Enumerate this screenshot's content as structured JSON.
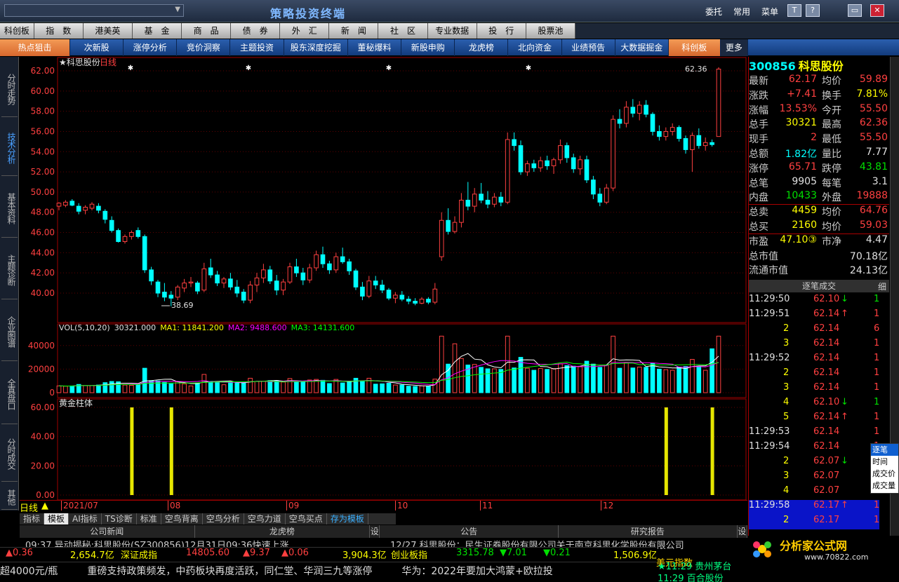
{
  "titlebar": {
    "app_title": "策略投资终端",
    "buttons": [
      "委托",
      "常用",
      "菜单"
    ],
    "win": [
      "T",
      "?",
      "▭",
      "✕"
    ]
  },
  "menubar": [
    "科创板",
    "指　数",
    "港美英",
    "基　金",
    "商　品",
    "债　券",
    "外　汇",
    "新　闻",
    "社　区",
    "专业数据",
    "投　行",
    "股票池"
  ],
  "subbar": [
    "热点狙击",
    "次新股",
    "涨停分析",
    "竞价洞察",
    "主题投资",
    "股东深度挖掘",
    "董秘爆料",
    "新股申购",
    "龙虎榜",
    "北向资金",
    "业绩预告",
    "大数据掘金",
    "科创板",
    "更多"
  ],
  "lefttabs": [
    "分时走势",
    "技术分析",
    "基本资料",
    "主题诊断",
    "企业图谱",
    "全真盘口",
    "分时成交",
    "其他"
  ],
  "chart": {
    "title": "★科思股份",
    "period": "日线",
    "price_axis": [
      "62.00",
      "60.00",
      "58.00",
      "56.00",
      "54.00",
      "52.00",
      "50.00",
      "48.00",
      "46.00",
      "44.00",
      "42.00",
      "40.00"
    ],
    "high_label": "62.36",
    "low_label": "38.69",
    "vol_legend": {
      "name": "VOL(5,10,20)",
      "vol": "30321.000",
      "ma1": "MA1: 11841.200",
      "ma2": "MA2: 9488.600",
      "ma3": "MA3: 14131.600"
    },
    "vol_axis": [
      "40000",
      "20000",
      "0"
    ],
    "gold_title": "黄金柱体",
    "gold_axis": [
      "60.00",
      "40.00",
      "20.00",
      "0.00"
    ],
    "date_labels": [
      "2021/07",
      "08",
      "09",
      "10",
      "11",
      "12"
    ],
    "period_label": "日线"
  },
  "chart_data": {
    "type": "candlestick",
    "title": "科思股份 日线",
    "ylim": [
      38,
      63
    ],
    "candles": [
      [
        48.6,
        49.0,
        48.2,
        48.9
      ],
      [
        48.7,
        49.2,
        48.5,
        49.0
      ],
      [
        49.1,
        49.3,
        48.6,
        48.7
      ],
      [
        48.6,
        48.9,
        47.8,
        48.1
      ],
      [
        48.2,
        48.7,
        47.8,
        48.5
      ],
      [
        48.4,
        49.0,
        48.2,
        48.8
      ],
      [
        48.6,
        48.9,
        47.9,
        48.2
      ],
      [
        48.1,
        48.3,
        46.9,
        47.3
      ],
      [
        47.2,
        47.6,
        46.0,
        46.2
      ],
      [
        46.2,
        46.4,
        45.0,
        45.1
      ],
      [
        45.1,
        45.8,
        44.9,
        45.6
      ],
      [
        45.6,
        46.2,
        45.3,
        46.0
      ],
      [
        46.2,
        46.5,
        45.4,
        45.6
      ],
      [
        45.6,
        45.8,
        42.0,
        42.3
      ],
      [
        42.3,
        42.6,
        40.8,
        41.2
      ],
      [
        41.1,
        41.3,
        39.6,
        40.0
      ],
      [
        40.1,
        41.0,
        39.2,
        39.6
      ],
      [
        39.8,
        40.2,
        38.7,
        39.5
      ],
      [
        39.6,
        40.8,
        39.3,
        40.6
      ],
      [
        40.5,
        41.4,
        40.1,
        41.0
      ],
      [
        41.0,
        41.6,
        40.6,
        41.1
      ],
      [
        41.0,
        41.2,
        39.9,
        40.2
      ],
      [
        40.3,
        43.0,
        40.1,
        42.4
      ],
      [
        42.5,
        43.4,
        41.5,
        41.8
      ],
      [
        41.8,
        42.2,
        40.7,
        41.0
      ],
      [
        41.0,
        41.6,
        40.5,
        41.4
      ],
      [
        41.4,
        42.0,
        40.3,
        40.6
      ],
      [
        40.6,
        41.3,
        39.6,
        40.0
      ],
      [
        40.1,
        40.4,
        39.0,
        39.3
      ],
      [
        39.3,
        41.2,
        39.0,
        40.8
      ],
      [
        40.8,
        42.0,
        40.1,
        41.5
      ],
      [
        41.5,
        42.9,
        41.0,
        42.3
      ],
      [
        42.3,
        42.7,
        40.9,
        41.2
      ],
      [
        41.2,
        41.8,
        39.8,
        40.3
      ],
      [
        40.3,
        41.4,
        39.8,
        41.1
      ],
      [
        41.1,
        43.0,
        40.9,
        42.6
      ],
      [
        42.6,
        43.4,
        41.6,
        42.0
      ],
      [
        42.0,
        42.5,
        40.8,
        41.3
      ],
      [
        41.3,
        42.9,
        41.0,
        42.5
      ],
      [
        42.5,
        44.2,
        42.2,
        43.8
      ],
      [
        43.8,
        44.6,
        42.5,
        42.9
      ],
      [
        42.9,
        43.2,
        41.9,
        42.3
      ],
      [
        42.3,
        44.0,
        42.0,
        43.6
      ],
      [
        43.6,
        44.5,
        42.9,
        43.1
      ],
      [
        43.1,
        43.4,
        41.8,
        42.2
      ],
      [
        42.2,
        42.4,
        40.3,
        40.6
      ],
      [
        40.6,
        41.1,
        39.3,
        39.7
      ],
      [
        39.7,
        41.7,
        39.5,
        41.2
      ],
      [
        41.2,
        41.7,
        40.4,
        40.8
      ],
      [
        40.8,
        41.3,
        40.0,
        40.3
      ],
      [
        40.3,
        40.5,
        39.3,
        39.5
      ],
      [
        39.5,
        40.1,
        39.0,
        39.8
      ],
      [
        39.8,
        40.2,
        39.2,
        39.4
      ],
      [
        39.4,
        39.7,
        38.9,
        39.2
      ],
      [
        39.2,
        39.5,
        38.8,
        39.0
      ],
      [
        39.0,
        39.6,
        38.9,
        39.4
      ],
      [
        39.4,
        39.6,
        38.9,
        39.1
      ],
      [
        39.1,
        41.0,
        38.9,
        40.4
      ],
      [
        43.6,
        48.0,
        43.2,
        47.2
      ],
      [
        47.2,
        48.4,
        45.8,
        46.1
      ],
      [
        46.1,
        47.6,
        45.9,
        47.0
      ],
      [
        47.0,
        49.9,
        46.5,
        49.2
      ],
      [
        49.2,
        51.0,
        48.2,
        48.6
      ],
      [
        48.6,
        50.4,
        48.0,
        49.8
      ],
      [
        49.8,
        50.9,
        48.9,
        49.2
      ],
      [
        49.2,
        50.1,
        48.4,
        48.8
      ],
      [
        48.8,
        49.9,
        48.5,
        49.5
      ],
      [
        49.5,
        50.0,
        48.6,
        49.0
      ],
      [
        49.0,
        55.9,
        48.8,
        55.2
      ],
      [
        55.2,
        55.9,
        54.1,
        54.6
      ],
      [
        54.6,
        55.1,
        51.7,
        52.0
      ],
      [
        52.0,
        53.1,
        51.6,
        52.8
      ],
      [
        52.8,
        53.2,
        52.0,
        52.4
      ],
      [
        52.4,
        53.5,
        52.0,
        53.1
      ],
      [
        53.1,
        53.6,
        52.2,
        52.6
      ],
      [
        52.6,
        53.4,
        51.8,
        53.2
      ],
      [
        53.2,
        55.2,
        52.8,
        54.6
      ],
      [
        54.6,
        54.9,
        52.9,
        53.4
      ],
      [
        53.4,
        53.8,
        51.9,
        52.3
      ],
      [
        52.3,
        53.6,
        51.7,
        53.2
      ],
      [
        53.2,
        53.6,
        50.9,
        51.2
      ],
      [
        51.2,
        51.6,
        49.3,
        49.8
      ],
      [
        49.8,
        50.4,
        48.6,
        49.0
      ],
      [
        49.0,
        50.8,
        48.8,
        50.4
      ],
      [
        50.4,
        57.6,
        50.1,
        57.2
      ],
      [
        57.2,
        58.2,
        56.3,
        56.8
      ],
      [
        56.8,
        59.0,
        56.4,
        58.4
      ],
      [
        58.4,
        59.2,
        57.4,
        57.8
      ],
      [
        57.8,
        59.0,
        57.1,
        58.6
      ],
      [
        58.6,
        59.1,
        57.4,
        57.7
      ],
      [
        57.7,
        57.9,
        55.6,
        56.0
      ],
      [
        56.0,
        56.6,
        55.1,
        55.5
      ],
      [
        55.5,
        56.4,
        55.1,
        56.0
      ],
      [
        56.0,
        56.8,
        55.6,
        56.4
      ],
      [
        56.4,
        56.6,
        55.0,
        55.3
      ],
      [
        55.3,
        55.6,
        53.8,
        54.2
      ],
      [
        54.2,
        55.9,
        52.0,
        55.6
      ],
      [
        55.6,
        56.3,
        54.3,
        54.6
      ],
      [
        54.6,
        55.4,
        54.1,
        54.9
      ],
      [
        54.9,
        55.2,
        54.5,
        54.7
      ],
      [
        55.5,
        62.36,
        55.5,
        62.17
      ]
    ],
    "ma_visible": true,
    "volume": {
      "series": [
        {
          "name": "VOL",
          "last": 30321
        },
        {
          "name": "MA1",
          "last": 11841.2
        },
        {
          "name": "MA2",
          "last": 9488.6
        },
        {
          "name": "MA3",
          "last": 14131.6
        }
      ],
      "ylim": [
        0,
        50000
      ]
    },
    "gold_bars": {
      "name": "黄金柱体",
      "ylim": [
        0,
        60
      ],
      "positions": [
        11,
        17,
        92,
        99
      ]
    },
    "x_labels": [
      "2021/07",
      "08",
      "09",
      "10",
      "11",
      "12"
    ]
  },
  "quote": {
    "code": "300856",
    "name": "科思股份",
    "rows": [
      [
        "最新",
        "62.17",
        "red",
        "均价",
        "59.89",
        "red"
      ],
      [
        "涨跌",
        "+7.41",
        "red",
        "换手",
        "7.81%",
        "yellow"
      ],
      [
        "涨幅",
        "13.53%",
        "red",
        "今开",
        "55.50",
        "red"
      ],
      [
        "总手",
        "30321",
        "yellow",
        "最高",
        "62.36",
        "red"
      ],
      [
        "现手",
        "2",
        "red",
        "最低",
        "55.50",
        "red"
      ],
      [
        "总额",
        "1.82亿",
        "cyan",
        "量比",
        "7.77",
        "white"
      ],
      [
        "涨停",
        "65.71",
        "red",
        "跌停",
        "43.81",
        "green"
      ],
      [
        "总笔",
        "9905",
        "white",
        "每笔",
        "3.1",
        "white"
      ],
      [
        "内盘",
        "10433",
        "green",
        "外盘",
        "19888",
        "red"
      ],
      [
        "总卖",
        "4459",
        "yellow",
        "均价",
        "64.76",
        "red"
      ],
      [
        "总买",
        "2160",
        "yellow",
        "均价",
        "59.03",
        "red"
      ],
      [
        "市盈",
        "47.10③",
        "yellow",
        "市净",
        "4.47",
        "white"
      ],
      [
        "总市值",
        "",
        "white",
        "",
        "70.18亿",
        "white"
      ],
      [
        "流通市值",
        "",
        "white",
        "",
        "24.13亿",
        "white"
      ]
    ],
    "tick_header": "逐笔成交",
    "tick_tab": "细",
    "ticks": [
      [
        "11:29:50",
        "62.10",
        "↓",
        "1"
      ],
      [
        "11:29:51",
        "62.14",
        "↑",
        "1"
      ],
      [
        "2",
        "62.14",
        "",
        "6"
      ],
      [
        "3",
        "62.14",
        "",
        "1"
      ],
      [
        "11:29:52",
        "62.14",
        "",
        "1"
      ],
      [
        "2",
        "62.14",
        "",
        "1"
      ],
      [
        "3",
        "62.14",
        "",
        "1"
      ],
      [
        "4",
        "62.10",
        "↓",
        "1"
      ],
      [
        "5",
        "62.14",
        "↑",
        "1"
      ],
      [
        "11:29:53",
        "62.14",
        "",
        "1"
      ],
      [
        "11:29:54",
        "62.14",
        "",
        "1"
      ],
      [
        "2",
        "62.07",
        "↓",
        "1"
      ],
      [
        "3",
        "62.07",
        "",
        "1"
      ],
      [
        "4",
        "62.07",
        "",
        "1"
      ],
      [
        "11:29:58",
        "62.17",
        "↑",
        "1"
      ],
      [
        "2",
        "62.17",
        "",
        "1"
      ]
    ]
  },
  "popup": [
    "逐笔",
    "时间",
    "成交价",
    "成交量"
  ],
  "tabstrip": [
    "指标",
    "模板",
    "AI指标",
    "TS诊断",
    "标准",
    "空鸟背离",
    "空鸟分析",
    "空鸟力道",
    "空鸟买点",
    "存为模板"
  ],
  "newsbar": [
    "公司新闻",
    "龙虎榜",
    "设",
    "公告",
    "研究报告",
    "设"
  ],
  "newsrow": {
    "left": "09:37 异动揭秘:科思股份(SZ300856)12月31日09:36快速上涨",
    "right": "12/27 科思股份：民生证券股份有限公司关于南京科思化学股份有限公司"
  },
  "indexbar": [
    [
      "▲0.36",
      "red"
    ],
    [
      "2,654.7亿",
      "yellow"
    ],
    [
      "深证成指",
      "yellow"
    ],
    [
      "14805.60",
      "red"
    ],
    [
      "▲9.37",
      "red"
    ],
    [
      "▲0.06",
      "red"
    ],
    [
      "3,904.3亿",
      "yellow"
    ],
    [
      "创业板指",
      "yellow"
    ],
    [
      "3315.78",
      "green"
    ],
    [
      "▼7.01",
      "green"
    ],
    [
      "▼0.21",
      "green"
    ],
    [
      "1,506.9亿",
      "yellow"
    ]
  ],
  "ticker": "超4000元/瓶　　　重磅支持政策频发，中药板块再度活跃，同仁堂、华润三九等涨停　　　华为：2022年要加大鸿蒙+欧拉投",
  "brbar": {
    "line1": "美元指数",
    "line2": "★11:29 贵州茅台",
    "line3": "11:29 百合股份"
  },
  "logo": {
    "text": "分析家公式网",
    "url": "www.70822.com"
  },
  "colors": {
    "up": "#ff4040",
    "down": "#00ffff",
    "grid": "#800000",
    "vol_ma1": "#ffffff",
    "vol_ma2": "#ff00ff",
    "vol_ma3": "#00ff00",
    "gold": "#e6e600"
  }
}
